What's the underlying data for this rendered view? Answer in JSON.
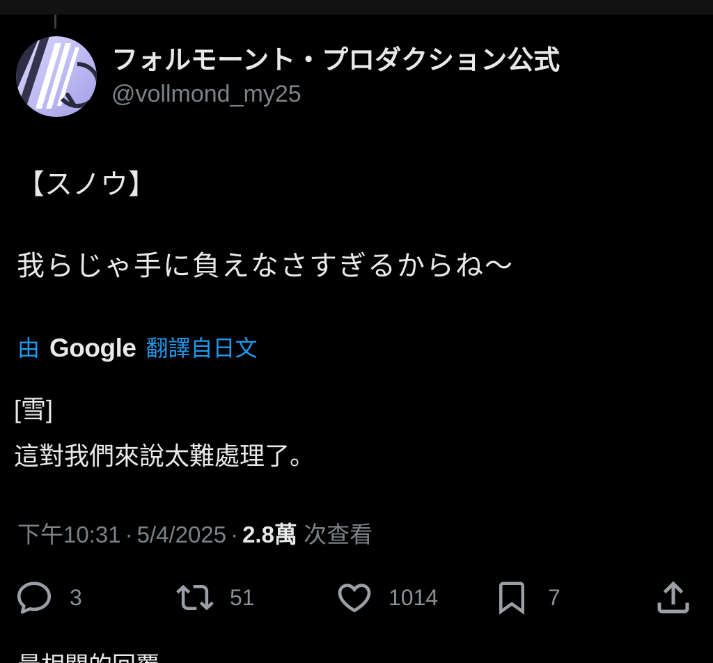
{
  "post": {
    "author": {
      "display_name": "フォルモーント・プロダクション公式",
      "handle": "@vollmond_my25",
      "avatar_icon": "vollmond-logo-avatar"
    },
    "text_lines": [
      "【スノウ】",
      "我らじゃ手に負えなさすぎるからね～"
    ],
    "translation": {
      "prefix": "由",
      "provider": "Google",
      "suffix": "翻譯自日文",
      "lines": [
        "[雪]",
        "這對我們來說太難處理了。"
      ]
    },
    "meta": {
      "time": "下午10:31",
      "separator": "·",
      "date": "5/4/2025",
      "views_count": "2.8萬",
      "views_label": "次查看"
    },
    "actions": {
      "reply": {
        "icon": "reply-icon",
        "count": "3"
      },
      "repost": {
        "icon": "repost-icon",
        "count": "51"
      },
      "like": {
        "icon": "heart-icon",
        "count": "1014"
      },
      "bookmark": {
        "icon": "bookmark-icon",
        "count": "7"
      },
      "share": {
        "icon": "share-icon"
      }
    }
  },
  "replies_header": "最相關的回覆",
  "colors": {
    "background": "#000000",
    "text": "#e7e9ea",
    "muted": "#7d8287",
    "link": "#1d9bf0",
    "icon": "#9aa0a6",
    "count": "#8b9096",
    "top_strip": "#121212"
  }
}
